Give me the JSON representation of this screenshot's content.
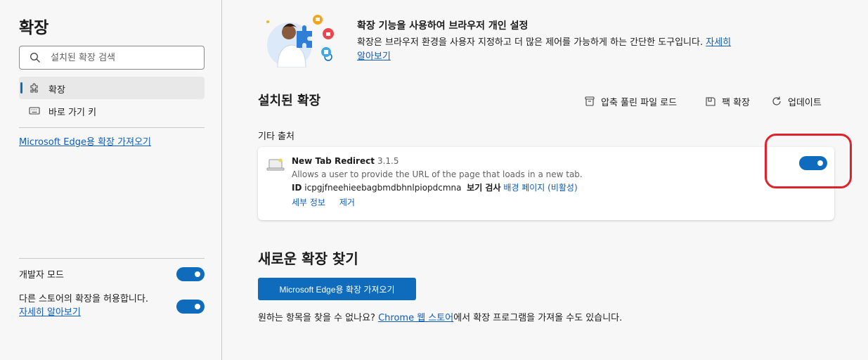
{
  "sidebar": {
    "title": "확장",
    "search_placeholder": "설치된 확장 검색",
    "nav": [
      {
        "label": "확장",
        "active": true
      },
      {
        "label": "바로 가기 키",
        "active": false
      }
    ],
    "get_extensions_link": "Microsoft Edge용 확장 가져오기",
    "developer_mode_label": "개발자 모드",
    "developer_mode_on": true,
    "allow_stores_label": "다른 스토어의 확장을 허용합니다.",
    "allow_stores_link": "자세히 알아보기",
    "allow_stores_on": true
  },
  "hero": {
    "title": "확장 기능을 사용하여 브라우저 개인 설정",
    "description": "확장은 브라우저 환경을 사용자 지정하고 더 많은 제어를 가능하게 하는 간단한 도구입니다.",
    "link": "자세히 알아보기"
  },
  "installed": {
    "title": "설치된 확장",
    "toolbar": {
      "load_unpacked": "압축 풀린 파일 로드",
      "pack": "팩 확장",
      "update": "업데이트"
    },
    "source_header": "기타 출처",
    "extension": {
      "name": "New Tab Redirect",
      "version": "3.1.5",
      "description": "Allows a user to provide the URL of the page that loads in a new tab.",
      "id_label": "ID",
      "id": "icpgjfneehieebagbmdbhnlpiopdcmna",
      "inspect_label": "보기 검사",
      "background_link": "배경 페이지 (비활성)",
      "details": "세부 정보",
      "remove": "제거",
      "enabled": true
    }
  },
  "find": {
    "title": "새로운 확장 찾기",
    "button": "Microsoft Edge용 확장 가져오기",
    "desc_before": "원하는 항목을 찾을 수 없나요? ",
    "chrome_link": "Chrome 웹 스토어",
    "desc_after": "에서 확장 프로그램을 가져올 수도 있습니다."
  },
  "colors": {
    "accent": "#0f6cbd",
    "link": "#0f5cb4",
    "highlight": "#e0232b"
  }
}
